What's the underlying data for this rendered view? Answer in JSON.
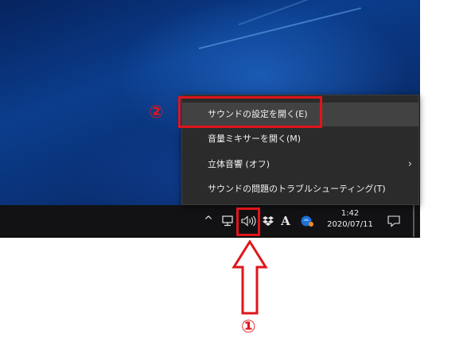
{
  "context_menu": {
    "items": [
      {
        "label": "サウンドの設定を開く(E)",
        "highlighted": true
      },
      {
        "label": "音量ミキサーを開く(M)"
      },
      {
        "label": "立体音響 (オフ)",
        "submenu_indicator": "›"
      },
      {
        "label": "サウンドの問題のトラブルシューティング(T)"
      }
    ]
  },
  "taskbar": {
    "tray_chevron": "^",
    "ime_indicator": "A",
    "clock": {
      "time": "1:42",
      "date": "2020/07/11"
    },
    "icons": [
      "chevron-up-icon",
      "network-icon",
      "volume-icon",
      "dropbox-icon",
      "ime-icon",
      "app-icon",
      "action-center-icon"
    ]
  },
  "annotations": {
    "step1_label": "①",
    "step2_label": "②",
    "highlight_color": "#e0151a"
  }
}
